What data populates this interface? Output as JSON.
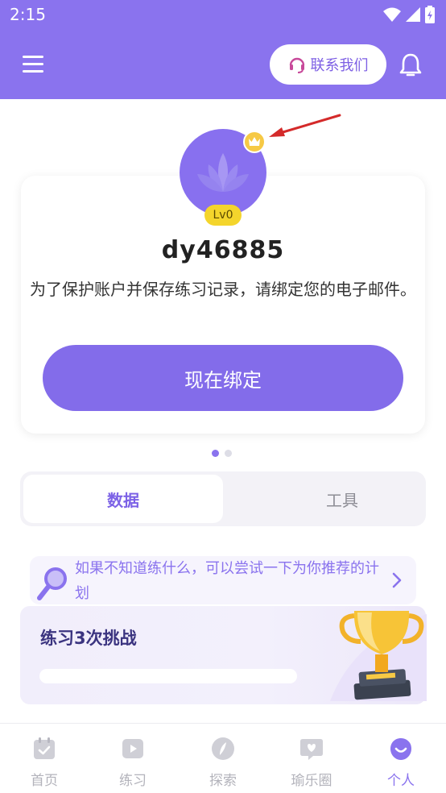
{
  "status_bar": {
    "time": "2:15"
  },
  "header": {
    "contact_label": "联系我们"
  },
  "profile": {
    "level": "Lv0",
    "username": "dy46885",
    "bind_notice": "为了保护账户并保存练习记录，请绑定您的电子邮件。",
    "bind_button": "现在绑定"
  },
  "tabs": [
    {
      "label": "数据",
      "active": true
    },
    {
      "label": "工具",
      "active": false
    }
  ],
  "suggestion": {
    "text": "如果不知道练什么，可以尝试一下为你推荐的计划"
  },
  "challenge": {
    "title": "练习3次挑战",
    "progress": 0
  },
  "bottom_nav": [
    {
      "label": "首页",
      "icon": "calendar-icon"
    },
    {
      "label": "练习",
      "icon": "play-icon"
    },
    {
      "label": "探索",
      "icon": "compass-icon"
    },
    {
      "label": "瑜乐圈",
      "icon": "heart-chat-icon"
    },
    {
      "label": "个人",
      "icon": "profile-smile-icon",
      "active": true
    }
  ],
  "colors": {
    "accent": "#8a73ee",
    "button": "#836cea",
    "badge": "#f4d52c",
    "crown": "#f6c945"
  }
}
